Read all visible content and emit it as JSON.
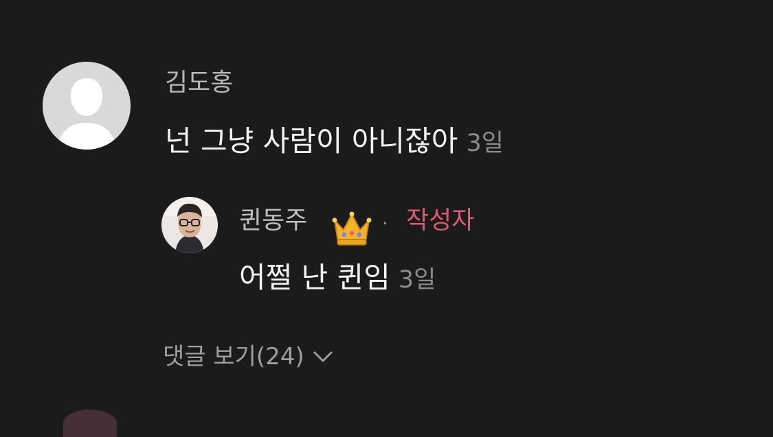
{
  "comments": [
    {
      "author": "김도홍",
      "text": "넌 그냥 사람이 아니잖아",
      "time": "3일",
      "avatar_icon": "default-user-icon",
      "avatar_bg": "#d9d9d9"
    }
  ],
  "reply": {
    "author": "퀸동주",
    "separator": "·",
    "owner_badge": "작성자",
    "text": "어쩔 난 퀸임",
    "time": "3일",
    "author_icon": "crown-icon",
    "avatar_icon": "profile-photo-icon",
    "badge_color": "#e05a6f"
  },
  "view_replies": {
    "label": "댓글 보기(24)",
    "icon": "chevron-down-icon"
  },
  "colors": {
    "background": "#1c1b1c",
    "text_primary": "#f2f2f2",
    "text_secondary": "#b8b8b8",
    "muted": "#8c8c8c"
  }
}
